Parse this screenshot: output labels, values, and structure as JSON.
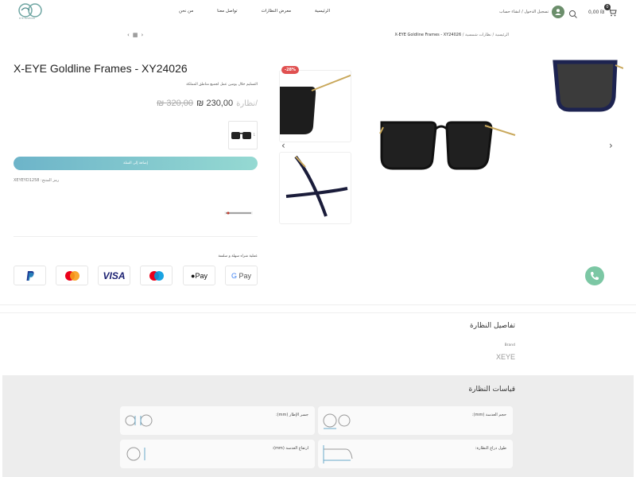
{
  "header": {
    "logo_text": "EYE FASHION",
    "cart_amount": "0,00 ₪",
    "cart_count": "0",
    "account_label": "تسجيل الدخول / انشاء حساب",
    "nav": [
      "الرئيسية",
      "معرض النظارات",
      "تواصل معنا",
      "من نحن"
    ]
  },
  "breadcrumb": {
    "home": "الرئيسية",
    "category": "نظارات شمسية",
    "current": "X-EYE Goldline Frames - XY24026"
  },
  "product": {
    "title": "X-EYE Goldline Frames - XY24026",
    "shipping_note": "التسليم خلال يومين عمل لجميع مناطق المملكة",
    "price_old": "320,00 ₪",
    "price_new": "230,00 ₪",
    "price_unit": "/نظارة",
    "swatch_count": "1",
    "add_to_cart": "إضافة إلى السلة",
    "sku_label": "رمز المنتج:",
    "sku_value": "XEYEYD1258",
    "sale_badge": "-28%",
    "payment_label": "عملية شراء سهلة و سلسة",
    "payments": [
      "PayPal",
      "Mastercard",
      "VISA",
      "Maestro",
      "Apple Pay",
      "Google Pay"
    ]
  },
  "details": {
    "title": "تفاصيل النظارة",
    "brand_label": "Brand",
    "brand_value": "XEYE"
  },
  "measurements": {
    "title": "قياسات النظارة",
    "items": [
      {
        "label": "حجم العدسة (mm):"
      },
      {
        "label": "جسر الإطار (mm):"
      },
      {
        "label": "طول ذراع النظارة:"
      },
      {
        "label": "ارتفاع العدسة (mm):"
      }
    ]
  },
  "colors": {
    "accent_start": "#6db4c9",
    "accent_end": "#95d9d2",
    "sale": "#e05050",
    "phone": "#7cc7a4"
  }
}
